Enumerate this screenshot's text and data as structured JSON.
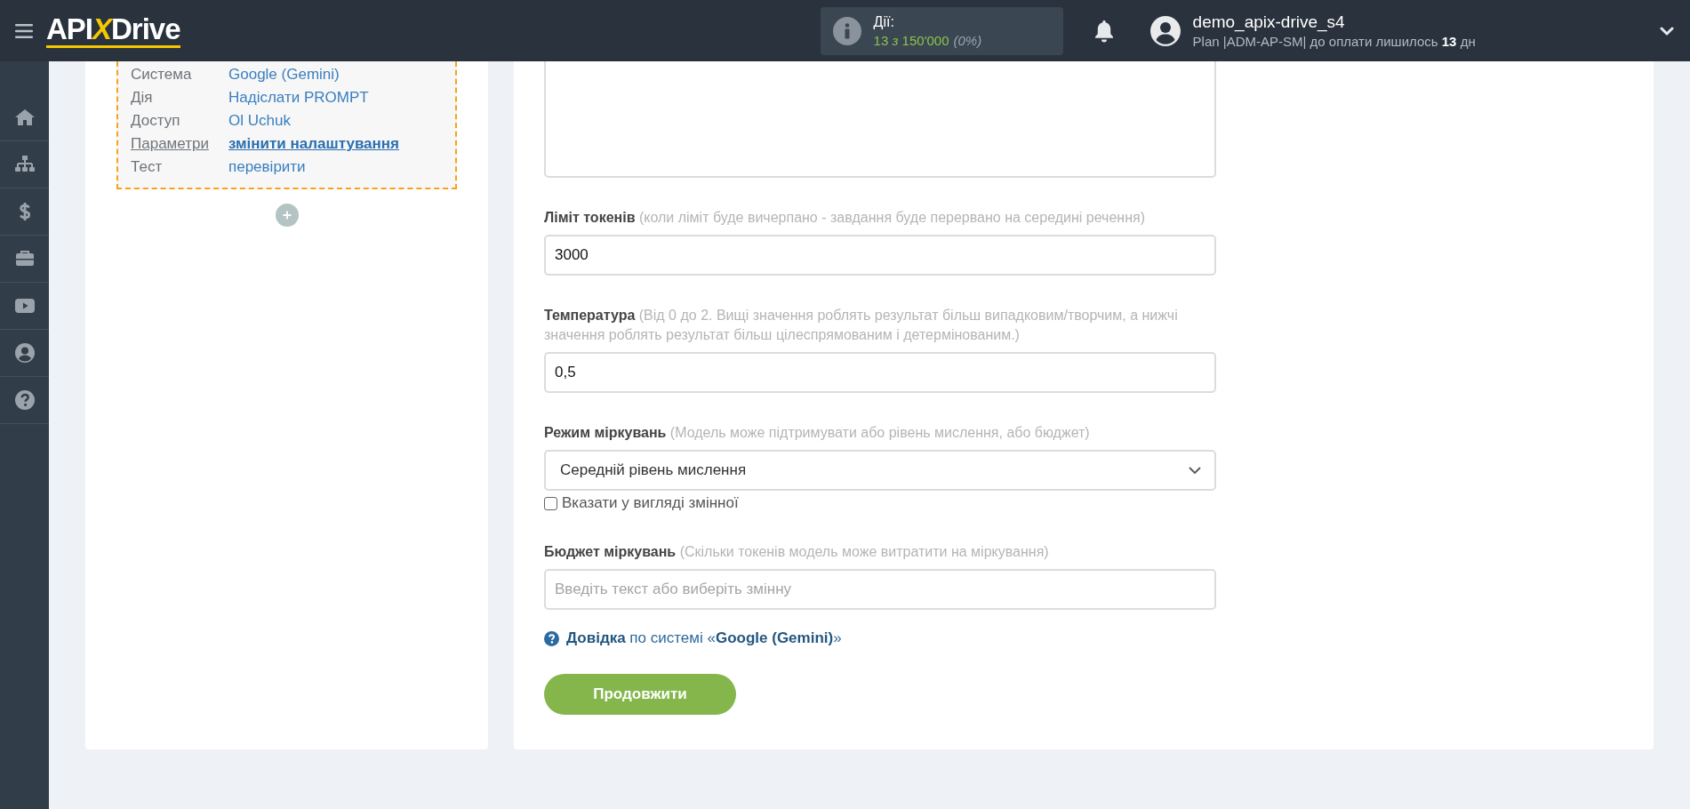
{
  "header": {
    "logo": [
      {
        "text": "API",
        "accent": false
      },
      {
        "text": "X",
        "accent": true
      },
      {
        "text": "Drive",
        "accent": false
      }
    ],
    "actions": {
      "label": "Дії:",
      "value": "13 *з* 150'000",
      "percent": "(0%)"
    },
    "user": {
      "name": "demo_apix-drive_s4",
      "plan": "Plan |ADM-AP-SM| до оплати лишилось **13** дн"
    }
  },
  "connection": {
    "rows": [
      {
        "label": "Система",
        "value": "Google (Gemini)",
        "kind": "text"
      },
      {
        "label": "Дія",
        "value": "Надіслати PROMPT",
        "kind": "text"
      },
      {
        "label": "Доступ",
        "value": "Ol Uchuk",
        "kind": "text"
      },
      {
        "label": "Параметри",
        "value": "змінити налаштування",
        "kind": "link"
      },
      {
        "label": "Тест",
        "value": "перевірити",
        "kind": "text"
      }
    ]
  },
  "form": {
    "fields": [
      {
        "kind": "input",
        "label": "Ліміт токенів",
        "hint": "(коли ліміт буде вичерпано - завдання буде перервано на середині речення)",
        "value": "3000"
      },
      {
        "kind": "input",
        "label": "Температура",
        "hint": "(Від 0 до 2. Вищі значення роблять результат більш випадковим/творчим, а нижчі значення роблять результат більш цілеспрямованим і детермінованим.)",
        "value": "0,5"
      },
      {
        "kind": "select",
        "label": "Режим міркувань",
        "hint": "(Модель може підтримувати або рівень мислення, або бюджет)",
        "value": "Середній рівень мислення",
        "checkbox": {
          "label": "Вказати у вигляді змінної",
          "checked": false
        }
      },
      {
        "kind": "input",
        "label": "Бюджет міркувань",
        "hint": "(Скільки токенів модель може витратити на міркування)",
        "placeholder": "Введіть текст або виберіть змінну"
      }
    ],
    "help": "**Довідка** по системі «**Google (Gemini)**»",
    "button": "Продовжити"
  }
}
